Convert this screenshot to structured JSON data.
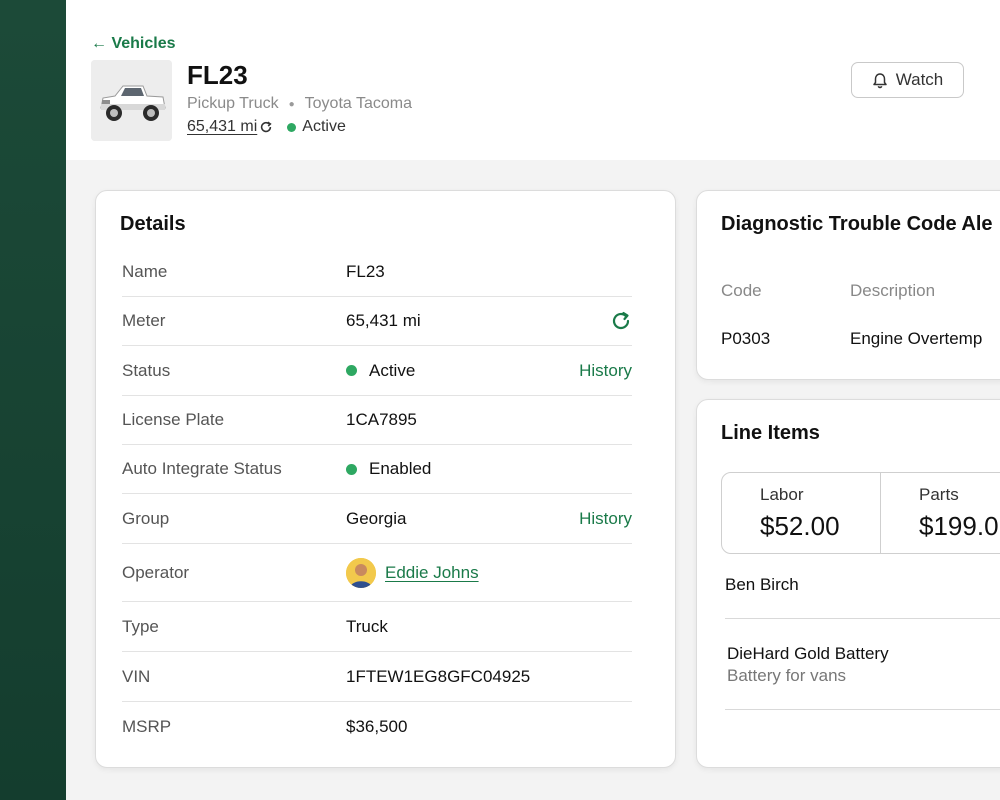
{
  "header": {
    "back_label": "← Vehicles",
    "vehicle_name": "FL23",
    "vehicle_type": "Pickup Truck",
    "vehicle_model": "Toyota Tacoma",
    "meter": "65,431 mi",
    "status": "Active",
    "watch_label": "Watch"
  },
  "details": {
    "title": "Details",
    "rows": [
      {
        "label": "Name",
        "value": "FL23"
      },
      {
        "label": "Meter",
        "value": "65,431 mi"
      },
      {
        "label": "Status",
        "value": "Active",
        "action": "History"
      },
      {
        "label": "License Plate",
        "value": "1CA7895"
      },
      {
        "label": "Auto Integrate Status",
        "value": "Enabled"
      },
      {
        "label": "Group",
        "value": "Georgia",
        "action": "History"
      },
      {
        "label": "Operator",
        "value": "Eddie Johns"
      },
      {
        "label": "Type",
        "value": "Truck"
      },
      {
        "label": "VIN",
        "value": "1FTEW1EG8GFC04925"
      },
      {
        "label": "MSRP",
        "value": "$36,500"
      }
    ]
  },
  "dtc": {
    "title": "Diagnostic Trouble Code Ale",
    "columns": [
      "Code",
      "Description"
    ],
    "rows": [
      {
        "code": "P0303",
        "description": "Engine Overtemp"
      }
    ]
  },
  "line_items": {
    "title": "Line Items",
    "costs": [
      {
        "label": "Labor",
        "value": "$52.00"
      },
      {
        "label": "Parts",
        "value": "$199.0"
      }
    ],
    "labor_name": "Ben Birch",
    "part_name": "DieHard Gold Battery",
    "part_description": "Battery for vans"
  },
  "colors": {
    "accent": "#1a7a49",
    "status_green": "#2ea862",
    "sidebar": "#1c4a38"
  }
}
